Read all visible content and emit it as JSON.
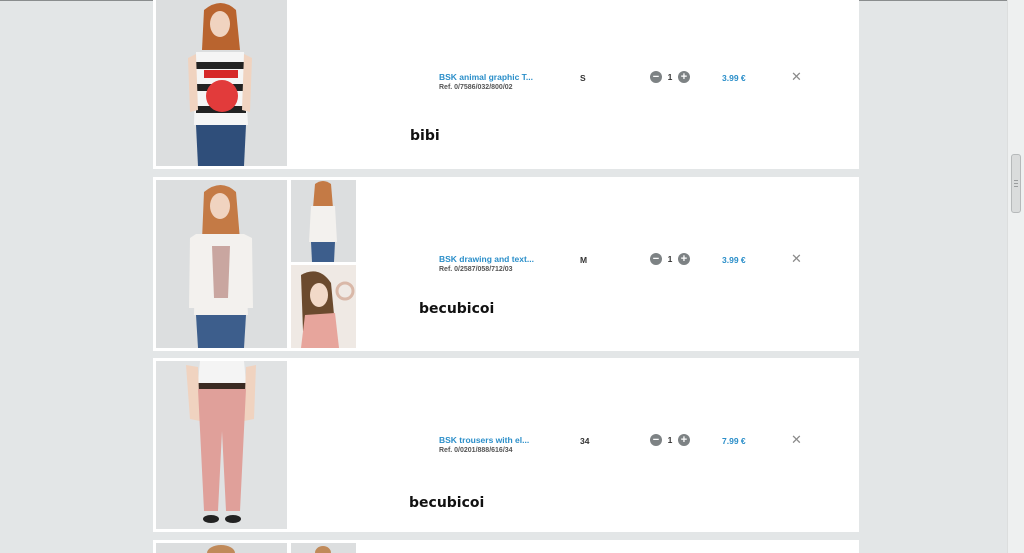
{
  "cart": {
    "items": [
      {
        "name": "BSK animal graphic T...",
        "ref": "Ref. 0/7586/032/800/02",
        "size": "S",
        "quantity": "1",
        "price": "3.99 €",
        "note": "bibi"
      },
      {
        "name": "BSK drawing and text...",
        "ref": "Ref. 0/2587/058/712/03",
        "size": "M",
        "quantity": "1",
        "price": "3.99 €",
        "note": "becubicoi"
      },
      {
        "name": "BSK trousers with el...",
        "ref": "Ref. 0/0201/888/616/34",
        "size": "34",
        "quantity": "1",
        "price": "7.99 €",
        "note": "becubicoi"
      }
    ],
    "quantity_decrease_symbol": "−",
    "quantity_increase_symbol": "+",
    "remove_symbol": "✕"
  },
  "colors": {
    "link_blue": "#2a8ec9",
    "page_background": "#e3e6e7",
    "quantity_button_grey": "#7d8284"
  }
}
